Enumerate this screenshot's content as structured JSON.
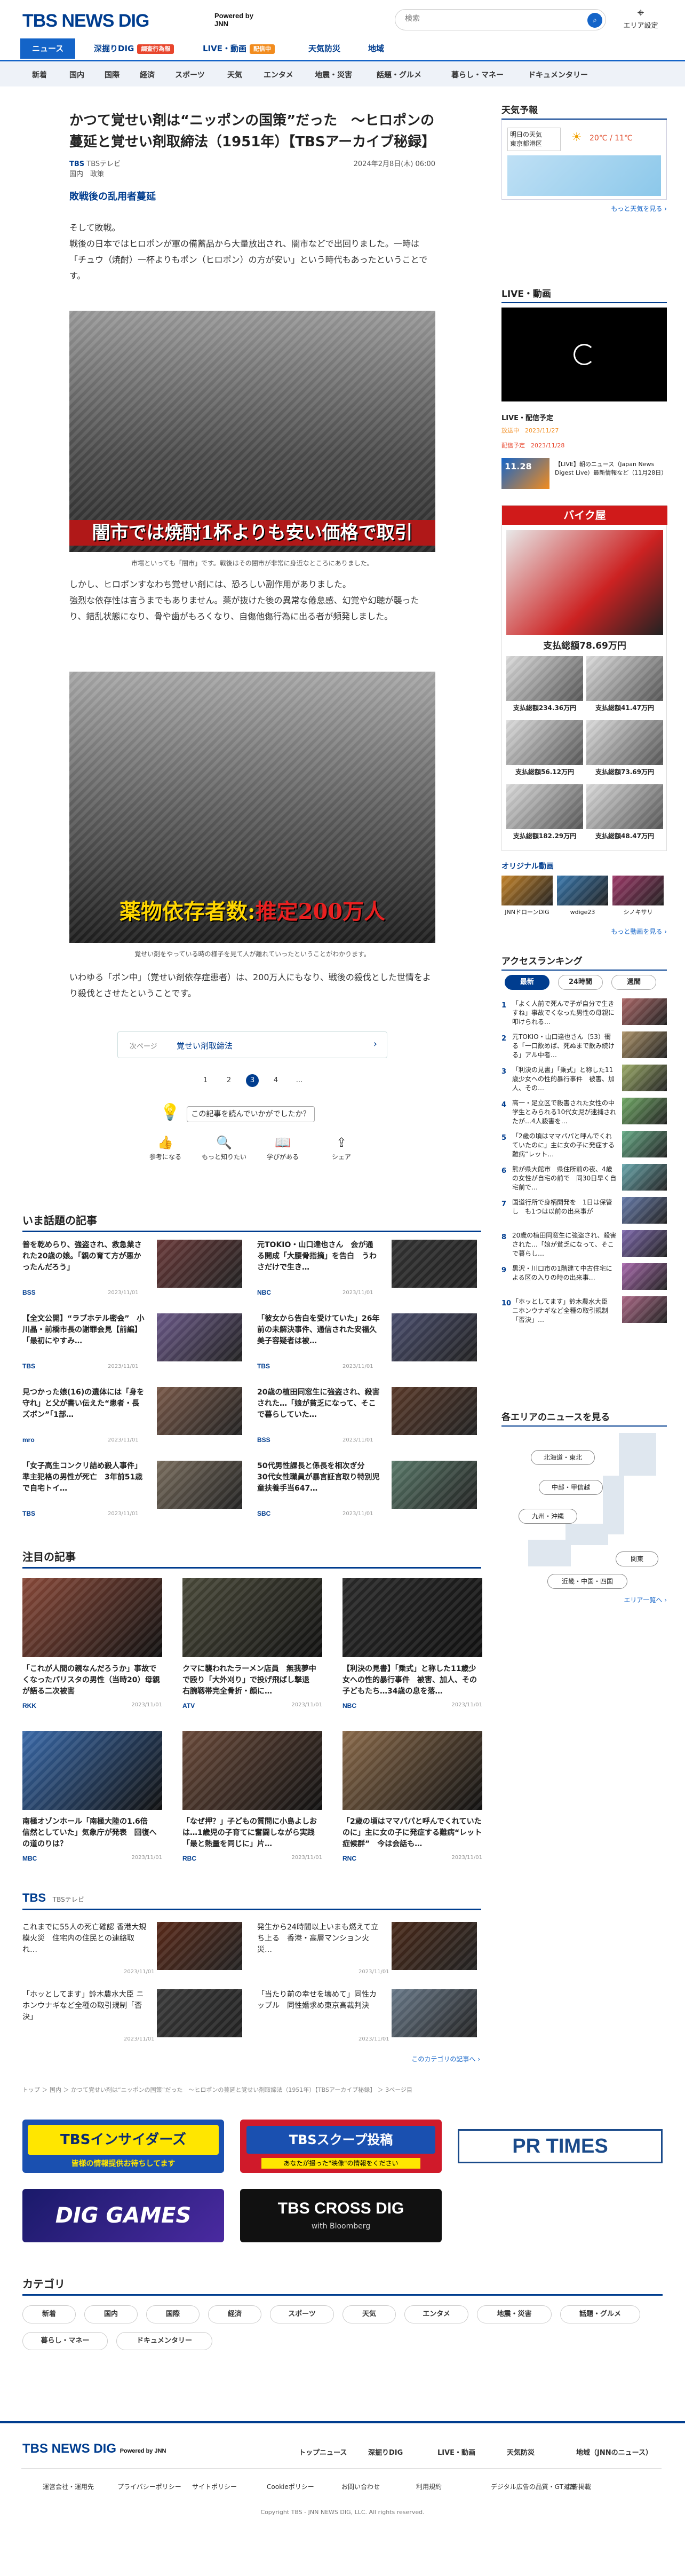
{
  "header": {
    "logo": "TBS NEWS DIG",
    "powered": "Powered by JNN",
    "search_placeholder": "検索",
    "search_icon": "search-icon",
    "area_label": "エリア設定",
    "area_icon": "pin-icon",
    "nav": [
      {
        "label": "ニュース",
        "active": true
      },
      {
        "label": "深掘りDIG",
        "badge": "調査行為報"
      },
      {
        "label": "LIVE・動画",
        "badge": "配信中"
      },
      {
        "label": "天気防災"
      },
      {
        "label": "地域"
      }
    ],
    "subnav": [
      "新着",
      "国内",
      "国際",
      "経済",
      "スポーツ",
      "天気",
      "エンタメ",
      "地震・災害",
      "話題・グルメ",
      "暮らし・マネー",
      "ドキュメンタリー"
    ]
  },
  "article": {
    "title": "かつて覚せい剤は“ニッポンの国策”だった　～ヒロポンの蔓延と覚せい剤取締法（1951年）【TBSアーカイブ秘録】",
    "source": "TBS",
    "source_sub": "TBSテレビ",
    "genre": "国内",
    "genre2": "政策",
    "date": "2024年2月8日(木) 06:00",
    "lead": "敗戦後の乱用者蔓延",
    "para1": "そして敗戦。\n戦後の日本ではヒロポンが軍の備蓄品から大量放出され、闇市などで出回りました。一時は「チュウ（焼酎）一杯よりもポン（ヒロポン）の方が安い」という時代もあったということです。",
    "img1_banner": "闇市では焼酎1杯よりも安い価格で取引",
    "img1_caption": "市場といっても「闇市」です。戦後はその闇市が非常に身近なところにありました。",
    "para2": "しかし、ヒロポンすなわち覚せい剤には、恐ろしい副作用がありました。\n強烈な依存性は言うまでもありません。薬が抜けた後の異常な倦怠感、幻覚や幻聴が襲ったり、錯乱状態になり、骨や歯がもろくなり、自傷他傷行為に出る者が頻発しました。",
    "img2_banner_a": "薬物依存者数:",
    "img2_banner_b": "推定200万人",
    "img2_caption": "覚せい剤をやっている時の様子を見て人が離れていったということがわかります。",
    "para3": "いわゆる「ポン中」（覚せい剤依存症患者）は、200万人にもなり、戦後の殺伐とした世情をより殺伐とさせたということです。",
    "link_label": "次ページ",
    "link_text": "覚せい剤取締法",
    "pages": [
      "1",
      "2",
      "3",
      "4",
      "..."
    ],
    "current_page": "3",
    "reaction_q": "この記事を読んでいかがでしたか？",
    "reactions": [
      "参考になる",
      "もっと知りたい",
      "学びがある",
      "シェア"
    ]
  },
  "trending": {
    "title": "いま話題の記事",
    "items": [
      {
        "title": "普を乾めらり、強盗され、救急業された20歳の娘。「親の育て方が悪かったんだろう」",
        "src": "BSS",
        "date": "2023/11/01",
        "img": "#6a3a3a"
      },
      {
        "title": "元TOKIO・山口達也さん　会が通る開成「大腰骨指摘」を告白　うわさだけで生き…",
        "src": "NBC",
        "date": "2023/11/01",
        "img": "#333"
      },
      {
        "title": "【全文公開】“ラブホテル密会”　小川晶・前橋市長の謝罪会見【前編】「最初にやすみ…",
        "src": "TBS",
        "date": "2023/11/01",
        "img": "#6c5a8a"
      },
      {
        "title": "「彼女から告白を受けていた」26年前の未解決事件、通信された安福久美子容疑者は被…",
        "src": "TBS",
        "date": "2023/11/01",
        "img": "#4a4e6e"
      },
      {
        "title": "見つかった娘(16)の遺体には「身を守れ」と父が書い伝えた“患者・長ズボン”「1部…",
        "src": "mro",
        "date": "2023/11/01",
        "img": "#7a5a4a"
      },
      {
        "title": "20歳の植田同窓生に強盗され、殺害された…「娘が貧乏になって、そこで暮らしていた…",
        "src": "BSS",
        "date": "2023/11/01",
        "img": "#5a3a2a"
      },
      {
        "title": "「女子高生コンクリ詰め殺人事件」準主犯格の男性が死亡　3年前51歳で自宅トイ…",
        "src": "TBS",
        "date": "2023/11/01",
        "img": "#7a6e5e"
      },
      {
        "title": "50代男性課長と係長を相次ぎ分　30代女性職員が暴言証言取り特別児童扶養手当647…",
        "src": "SBC",
        "date": "2023/11/01",
        "img": "#5a7a6a"
      }
    ]
  },
  "featured": {
    "title": "注目の記事",
    "items": [
      {
        "title": "「これが人間の親なんだろうか」事故でくなったパリスタの男性（当時20）母親が語る二次被害",
        "src": "RKK",
        "date": "2023/11/01",
        "img": "#8a4a3a"
      },
      {
        "title": "クマに襲われたラーメン店員　無我夢中で殴り「大外刈り」で投げ飛ばし撃退　右腕靱帯完全骨折・顔に…",
        "src": "ATV",
        "date": "2023/11/01",
        "img": "#4a4a3a"
      },
      {
        "title": "【利決の見書】「乗式」と称した11歳少女への性的暴行事件　被害、加人、その子どもたち…34歳の息を落…",
        "src": "NBC",
        "date": "2023/11/01",
        "img": "#2a2a2a"
      },
      {
        "title": "南極オゾンホール「南極大陸の1.6倍　信然としていた」気象庁が発表　回復への道のりは？",
        "src": "MBC",
        "date": "2023/11/01",
        "img": "#3a6aaa"
      },
      {
        "title": "「なぜ押？」子どもの質問に小島よしおは…1歳児の子育てに奮闘しながら実践「最と熱量を同じに」片…",
        "src": "RBC",
        "date": "2023/11/01",
        "img": "#6a4a3a"
      },
      {
        "title": "「2歳の頃はママパパと呼んでくれていたのに」主に女の子に発症する難病“レット症候群”　今は会話も…",
        "src": "RNC",
        "date": "2023/11/01",
        "img": "#8a6a4a"
      }
    ]
  },
  "tbs": {
    "title": "TBS",
    "sub": "TBSテレビ",
    "more": "このカテゴリの記事へ ›",
    "items": [
      {
        "title": "これまでに55人の死亡確認 香港大規模火災　住宅内の住民との連絡取れ…",
        "date": "2023/11/01",
        "img": "#5a2a1a"
      },
      {
        "title": "発生から24時間以上いまも燃えて立ち上る　香港・高層マンション火災…",
        "date": "2023/11/01",
        "img": "#4a2a1a"
      },
      {
        "title": "「ホッとしてます」鈴木農水大臣 ニホンウナギなど全種の取引規制「否決」",
        "date": "2023/11/01",
        "img": "#3a3a3a"
      },
      {
        "title": "「当たり前の幸せを壊めて」同性カップル　同性婚求め東京高裁判決",
        "date": "2023/11/01",
        "img": "#6a7a8a"
      }
    ]
  },
  "breadcrumb": "トップ ＞ 国内 ＞ かつて覚せい剤は“ニッポンの国策”だった　～ヒロポンの蔓延と覚せい剤取締法（1951年）【TBSアーカイブ秘録】 ＞ 3ページ目",
  "sidebar": {
    "weather_title": "天気予報",
    "weather_day": "明日の天気",
    "weather_region": "東京都港区",
    "weather_temp": "20℃ / 11℃",
    "weather_more": "もっと天気を見る ›",
    "live_title": "LIVE・動画",
    "live_sched_title": "LIVE・配信予定",
    "live_sched": [
      {
        "tag": "放送中",
        "date": "2023/11/27",
        "text": ""
      },
      {
        "tag": "配信予定",
        "date": "2023/11/28",
        "text": ""
      },
      {
        "tag": "",
        "date": "11.28",
        "text": "【LIVE】朝のニュース（Japan News Digest Live）最新情報など（11月28日）"
      }
    ],
    "bike_title": "バイク屋",
    "bike_price": "支払総額78.69万円",
    "bike_prices": [
      "支払総額234.36万円",
      "支払総額41.47万円",
      "支払総額56.12万円",
      "支払総額73.69万円",
      "支払総額182.29万円",
      "支払総額48.47万円"
    ],
    "orig_title": "オリジナル動画",
    "orig_items": [
      "JNNドローンDIG",
      "wdige23",
      "シノキサリ"
    ],
    "orig_more": "もっと動画を見る ›",
    "ranking_title": "アクセスランキング",
    "ranking_tabs": [
      "最新",
      "24時間",
      "週間"
    ],
    "ranking": [
      {
        "n": "1",
        "t": "「よく人前で死んで子が自分で生きすね」事故でくなった男性の母親に叩けられる…"
      },
      {
        "n": "2",
        "t": "元TOKIO・山口達也さん（53）衝る「一口飲めば、死ぬまで飲み続ける」アル中者…"
      },
      {
        "n": "3",
        "t": "「利決の見書」「乗式」と称した11歳少女への性的暴行事件　被害、加人、その…"
      },
      {
        "n": "4",
        "t": "高一・足立区で殺害された女性の中学生とみられる10代女児が逮捕されたが…4人殺害を…"
      },
      {
        "n": "5",
        "t": "「2歳の頃はママパパと呼んでくれていたのに」主に女の子に発症する難病“レット…"
      },
      {
        "n": "6",
        "t": "熊が県大館市　県住所前の夜、4歳の女性が自宅の前で　同30日早く自宅前で…"
      },
      {
        "n": "7",
        "t": "国道行所で身柄開発を　1日は保管し　も1つは以前の出来事が"
      },
      {
        "n": "8",
        "t": "20歳の植田同窓生に強盗され、殺害された…「娘が貧乏になって、そこで暮らし…"
      },
      {
        "n": "9",
        "t": "黒沢・川口市の1階建て中古住宅による区の入りの時の出来事…"
      },
      {
        "n": "10",
        "t": "「ホッとしてます」鈴木農水大臣　ニホンウナギなど全種の取引規制「否決」…"
      }
    ],
    "area_title": "各エリアのニュースを見る",
    "areas": [
      "北海道・東北",
      "中部・甲信越",
      "九州・沖縄",
      "関東",
      "近畿・中国・四国"
    ],
    "area_more": "エリア一覧へ ›"
  },
  "ads": {
    "insiders": "TBSインサイダーズ",
    "insiders_sub": "皆様の情報提供お待ちしてます",
    "scoop": "TBSスクープ投稿",
    "scoop_sub": "あなたが撮った\"映像\"の情報をください",
    "prtimes": "PR TIMES",
    "games": "DIG GAMES",
    "cross": "TBS CROSS DIG",
    "cross_sub": "with Bloomberg"
  },
  "categories": {
    "title": "カテゴリ",
    "items": [
      "新着",
      "国内",
      "国際",
      "経済",
      "スポーツ",
      "天気",
      "エンタメ",
      "地震・災害",
      "話題・グルメ",
      "暮らし・マネー",
      "ドキュメンタリー"
    ]
  },
  "footer": {
    "logo": "TBS NEWS DIG",
    "powered": "Powered by JNN",
    "nav": [
      "トップニュース",
      "深掘りDIG",
      "LIVE・動画",
      "天気防災",
      "地域（JNNのニュース）"
    ],
    "links": [
      "運営会社・運用先",
      "プライバシーポリシー",
      "サイトポリシー",
      "Cookieポリシー",
      "お問い合わせ",
      "利用規約",
      "デジタル広告の品質・GT対策",
      "広告掲載"
    ],
    "copyright": "Copyright TBS - JNN NEWS DIG, LLC. All rights reserved."
  }
}
